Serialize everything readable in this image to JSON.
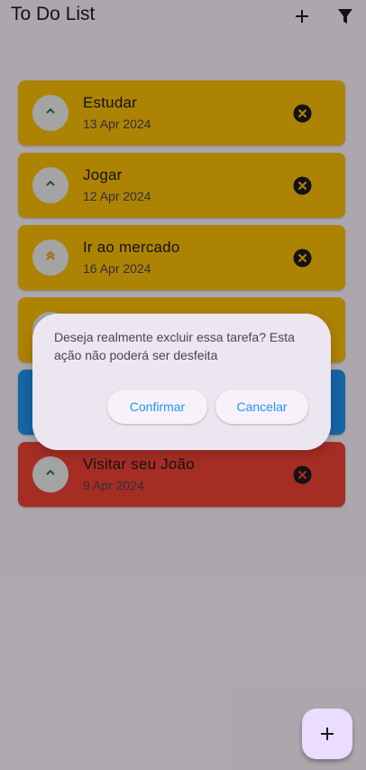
{
  "app": {
    "title": "To Do List",
    "add_icon": "plus-icon",
    "filter_icon": "filter-icon"
  },
  "tasks": [
    {
      "title": "Estudar",
      "date": "13 Apr 2024",
      "color": "#ffc107",
      "priority_icon": "chevron-up-icon",
      "priority_color": "#2e7d32"
    },
    {
      "title": "Jogar",
      "date": "12 Apr 2024",
      "color": "#ffc107",
      "priority_icon": "chevron-up-icon",
      "priority_color": "#2e7d32"
    },
    {
      "title": "Ir ao mercado",
      "date": "16 Apr 2024",
      "color": "#ffc107",
      "priority_icon": "double-chevron-up-icon",
      "priority_color": "#ff9800"
    },
    {
      "title": "",
      "date": "",
      "color": "#ffc107",
      "priority_icon": "chevron-up-icon",
      "priority_color": "#2e7d32"
    },
    {
      "title": "",
      "date": "",
      "color": "#2196f3",
      "priority_icon": "chevron-up-icon",
      "priority_color": "#2e7d32"
    },
    {
      "title": "Visitar seu João",
      "date": "9 Apr 2024",
      "color": "#f44336",
      "priority_icon": "chevron-up-icon",
      "priority_color": "#2e7d32"
    }
  ],
  "dialog": {
    "message": "Deseja realmente excluir essa tarefa? Esta ação não poderá ser desfeita",
    "confirm_label": "Confirmar",
    "cancel_label": "Cancelar"
  },
  "fab": {
    "icon": "plus-icon"
  },
  "colors": {
    "scrim": "#000000",
    "dialog_bg": "#ece6f0",
    "button_text": "#2196f3"
  }
}
